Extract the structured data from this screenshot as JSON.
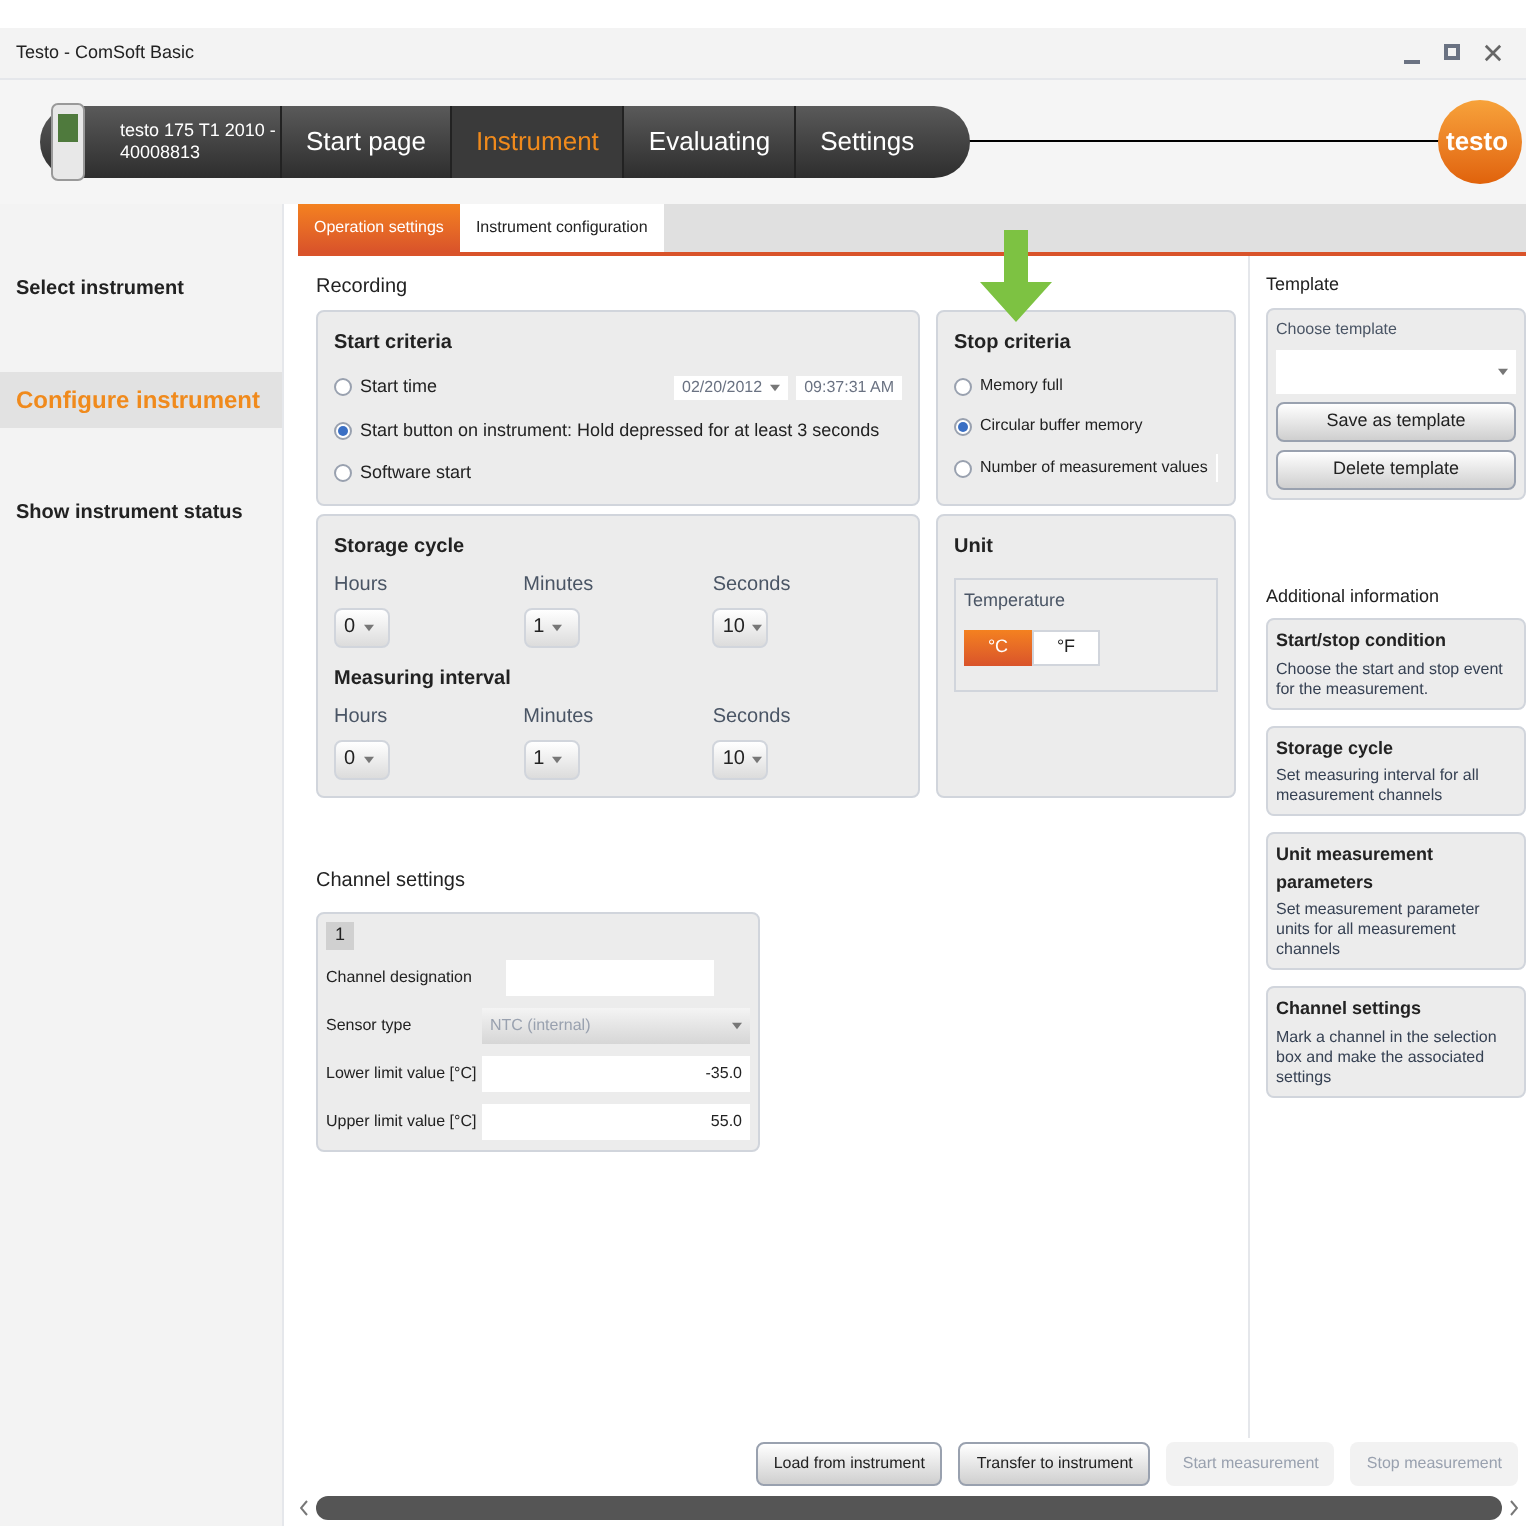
{
  "window": {
    "title": "Testo - ComSoft Basic"
  },
  "header": {
    "device": "testo 175 T1 2010 - 40008813",
    "logo": "testo",
    "nav": [
      {
        "label": "Start page",
        "selected": false
      },
      {
        "label": "Instrument",
        "selected": true
      },
      {
        "label": "Evaluating",
        "selected": false
      },
      {
        "label": "Settings",
        "selected": false
      }
    ]
  },
  "sidebar": {
    "items": [
      {
        "label": "Select instrument",
        "selected": false
      },
      {
        "label": "Configure instrument",
        "selected": true
      },
      {
        "label": "Show instrument status",
        "selected": false
      }
    ]
  },
  "subtabs": [
    {
      "label": "Operation settings",
      "selected": true
    },
    {
      "label": "Instrument configuration",
      "selected": false
    }
  ],
  "recording": {
    "title": "Recording",
    "start_criteria": {
      "title": "Start criteria",
      "date": "02/20/2012",
      "time": "09:37:31 AM",
      "options": [
        {
          "label": "Start time",
          "selected": false
        },
        {
          "label": "Start button on instrument: Hold depressed for at least 3 seconds",
          "selected": true
        },
        {
          "label": "Software start",
          "selected": false
        }
      ]
    },
    "stop_criteria": {
      "title": "Stop criteria",
      "options": [
        {
          "label": "Memory full",
          "selected": false,
          "kind": "plain"
        },
        {
          "label": "Circular buffer memory",
          "selected": true,
          "kind": "plain"
        },
        {
          "label": "Number of measurement values",
          "selected": false,
          "kind": "field"
        }
      ]
    },
    "storage_cycle": {
      "title": "Storage cycle",
      "fields": [
        {
          "label": "Hours",
          "value": "0"
        },
        {
          "label": "Minutes",
          "value": "1"
        },
        {
          "label": "Seconds",
          "value": "10"
        }
      ]
    },
    "measuring_interval": {
      "title": "Measuring interval",
      "fields": [
        {
          "label": "Hours",
          "value": "0"
        },
        {
          "label": "Minutes",
          "value": "1"
        },
        {
          "label": "Seconds",
          "value": "10"
        }
      ]
    },
    "unit": {
      "title": "Unit",
      "label": "Temperature",
      "options": [
        {
          "label": "°C",
          "selected": true
        },
        {
          "label": "°F",
          "selected": false
        }
      ]
    }
  },
  "template": {
    "title": "Template",
    "label": "Choose template",
    "buttons": [
      "Save as template",
      "Delete template"
    ]
  },
  "additional_info": {
    "title": "Additional information",
    "cards": [
      {
        "title": "Start/stop condition",
        "text": "Choose the start and stop event for the measurement."
      },
      {
        "title": "Storage cycle",
        "text": "Set measuring interval for all measurement channels"
      },
      {
        "title": "Unit measurement parameters",
        "text": "Set measurement parameter units for all measurement channels"
      },
      {
        "title": "Channel settings",
        "text": "Mark a channel in the selection box and make the associated settings"
      }
    ]
  },
  "channel_settings": {
    "title": "Channel settings",
    "channel": "1",
    "fields": [
      {
        "label": "Channel designation",
        "kind": "input"
      },
      {
        "label": "Sensor type",
        "value": "NTC (internal)",
        "kind": "select",
        "disabled": true
      },
      {
        "label": "Lower limit value  [°C]",
        "value": "-35.0",
        "kind": "number"
      },
      {
        "label": "Upper limit value  [°C]",
        "value": "55.0",
        "kind": "number"
      }
    ]
  },
  "actions": [
    {
      "label": "Load from instrument",
      "disabled": false
    },
    {
      "label": "Transfer to instrument",
      "disabled": false
    },
    {
      "label": "Start measurement",
      "disabled": true
    },
    {
      "label": "Stop measurement",
      "disabled": true
    }
  ]
}
